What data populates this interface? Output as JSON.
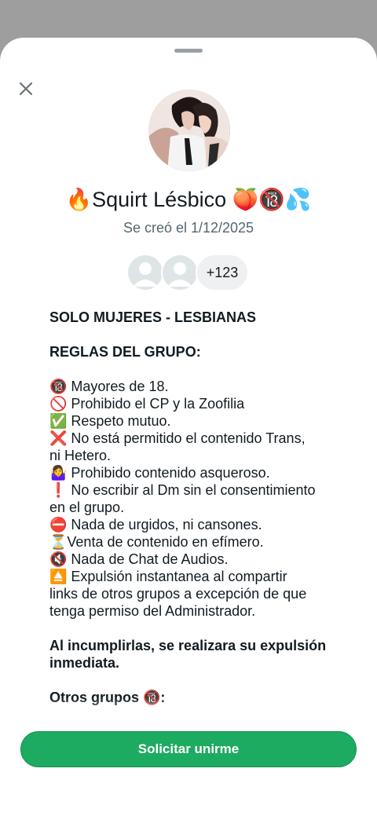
{
  "group": {
    "name": "🔥Squirt Lésbico 🍑🔞💦",
    "created": "Se creó el 1/12/2025",
    "member_more_count": "+123"
  },
  "icons": {
    "close": "close-icon",
    "group_avatar": "group-photo",
    "member_avatar": "default-person-avatar"
  },
  "description": {
    "lines": [
      {
        "text": "SOLO MUJERES - LESBIANAS",
        "bold": true
      },
      {
        "text": "",
        "bold": false
      },
      {
        "text": "REGLAS DEL GRUPO:",
        "bold": true
      },
      {
        "text": "",
        "bold": false
      },
      {
        "text": "🔞 Mayores de 18.",
        "bold": false
      },
      {
        "text": "🚫 Prohibido el CP y la Zoofilia",
        "bold": false
      },
      {
        "text": "✅ Respeto mutuo.",
        "bold": false
      },
      {
        "text": "❌ No está permitido el contenido Trans,",
        "bold": false
      },
      {
        "text": "ni Hetero.",
        "bold": false
      },
      {
        "text": "🤷‍♀️ Prohibido contenido asqueroso.",
        "bold": false
      },
      {
        "text": "❗ No escribir al Dm sin el consentimiento",
        "bold": false
      },
      {
        "text": "en el grupo.",
        "bold": false
      },
      {
        "text": "⛔ Nada de urgidos, ni cansones.",
        "bold": false
      },
      {
        "text": "⏳Venta de contenido en efímero.",
        "bold": false
      },
      {
        "text": "🔇 Nada de Chat de Audios.",
        "bold": false
      },
      {
        "text": "⏏️ Expulsión instantanea al compartir",
        "bold": false
      },
      {
        "text": "links de otros grupos a excepción de que",
        "bold": false
      },
      {
        "text": "tenga permiso del Administrador.",
        "bold": false
      },
      {
        "text": "",
        "bold": false
      },
      {
        "text": "Al incumplirlas, se realizara su expulsión",
        "bold": true
      },
      {
        "text": "inmediata.",
        "bold": true
      },
      {
        "text": "",
        "bold": false
      },
      {
        "text": "Otros grupos 🔞:",
        "bold": true
      }
    ]
  },
  "actions": {
    "join_label": "Solicitar unirme"
  },
  "colors": {
    "accent": "#1daa61",
    "scrim": "#9e9e9e",
    "secondary_text": "#54656f"
  }
}
